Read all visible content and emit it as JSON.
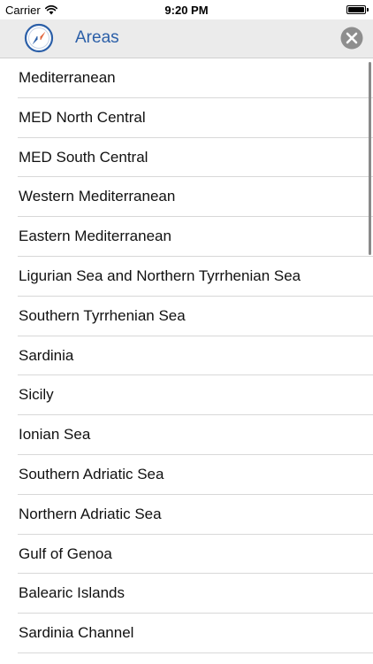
{
  "status_bar": {
    "carrier": "Carrier",
    "time": "9:20 PM",
    "wifi_icon": "wifi-icon",
    "battery_icon": "battery-icon",
    "battery_level": 1.0
  },
  "nav_bar": {
    "title": "Areas",
    "left_icon": "compass-icon",
    "right_icon": "close-icon",
    "accent_color": "#2b5fa8"
  },
  "areas": [
    {
      "label": "Mediterranean"
    },
    {
      "label": "MED North Central"
    },
    {
      "label": "MED South Central"
    },
    {
      "label": "Western Mediterranean"
    },
    {
      "label": "Eastern Mediterranean"
    },
    {
      "label": "Ligurian Sea and Northern Tyrrhenian Sea"
    },
    {
      "label": "Southern Tyrrhenian Sea"
    },
    {
      "label": "Sardinia"
    },
    {
      "label": "Sicily"
    },
    {
      "label": "Ionian Sea"
    },
    {
      "label": "Southern Adriatic Sea"
    },
    {
      "label": "Northern Adriatic Sea"
    },
    {
      "label": "Gulf of Genoa"
    },
    {
      "label": "Balearic Islands"
    },
    {
      "label": "Sardinia Channel"
    }
  ]
}
